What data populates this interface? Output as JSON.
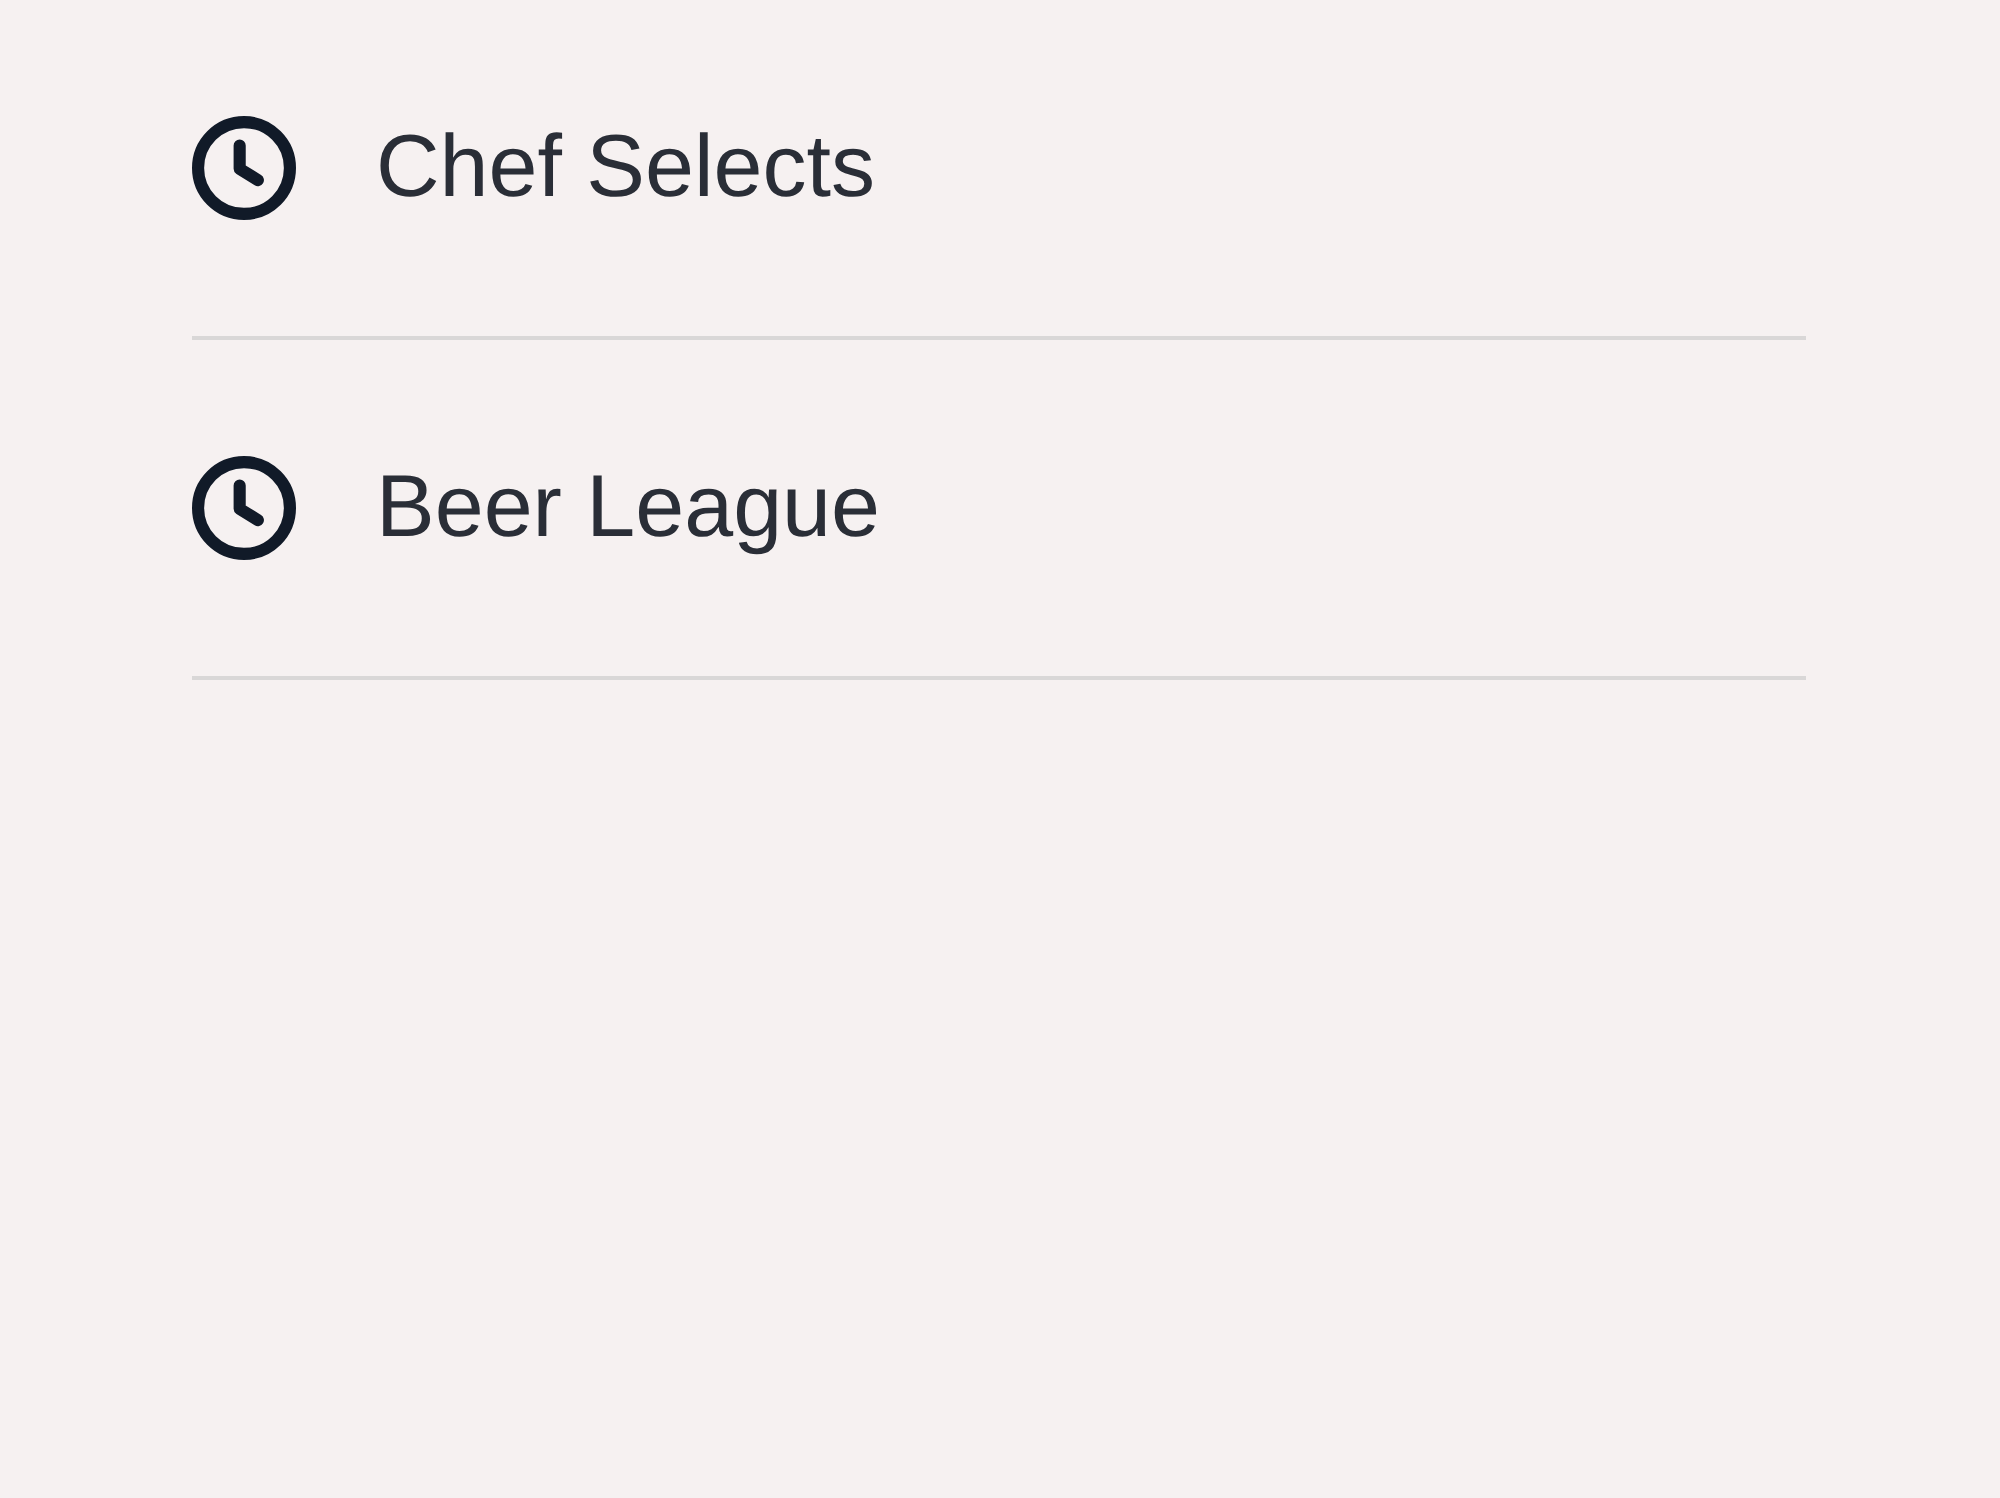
{
  "items": [
    {
      "label": "Chef Selects"
    },
    {
      "label": "Beer League"
    }
  ]
}
